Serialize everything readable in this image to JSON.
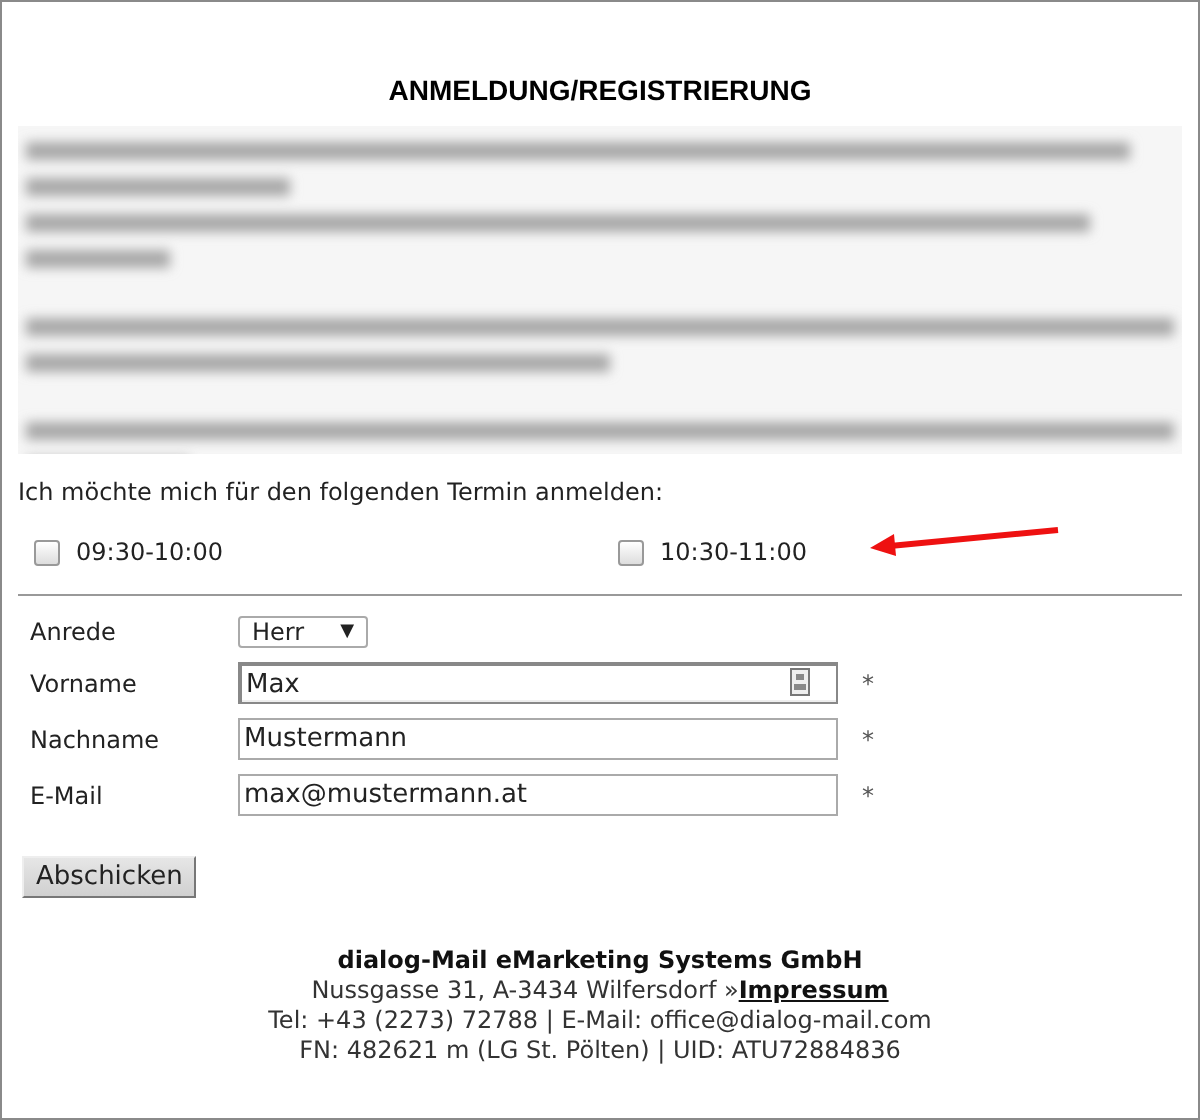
{
  "title": "ANMELDUNG/REGISTRIERUNG",
  "prompt": "Ich möchte mich für den folgenden Termin anmelden:",
  "slots": [
    {
      "label": "09:30-10:00",
      "checked": false
    },
    {
      "label": "10:30-11:00",
      "checked": false
    }
  ],
  "fields": [
    {
      "kind": "select",
      "label": "Anrede",
      "value": "Herr",
      "arrow": "▼"
    },
    {
      "kind": "text",
      "label": "Vorname",
      "value": "Max",
      "focused": true,
      "required": "*"
    },
    {
      "kind": "text",
      "label": "Nachname",
      "value": "Mustermann",
      "focused": false,
      "required": "*"
    },
    {
      "kind": "text",
      "label": "E-Mail",
      "value": "max@mustermann.at",
      "focused": false,
      "required": "*"
    }
  ],
  "submit": "Abschicken",
  "footer": {
    "company": "dialog-Mail eMarketing Systems GmbH",
    "address": "Nussgasse 31, A-3434 Wilfersdorf »",
    "link": "Impressum",
    "contact": "Tel: +43 (2273) 72788 | E-Mail: office@dialog-mail.com",
    "register": "FN: 482621 m (LG St. Pölten) | UID: ATU72884836"
  }
}
